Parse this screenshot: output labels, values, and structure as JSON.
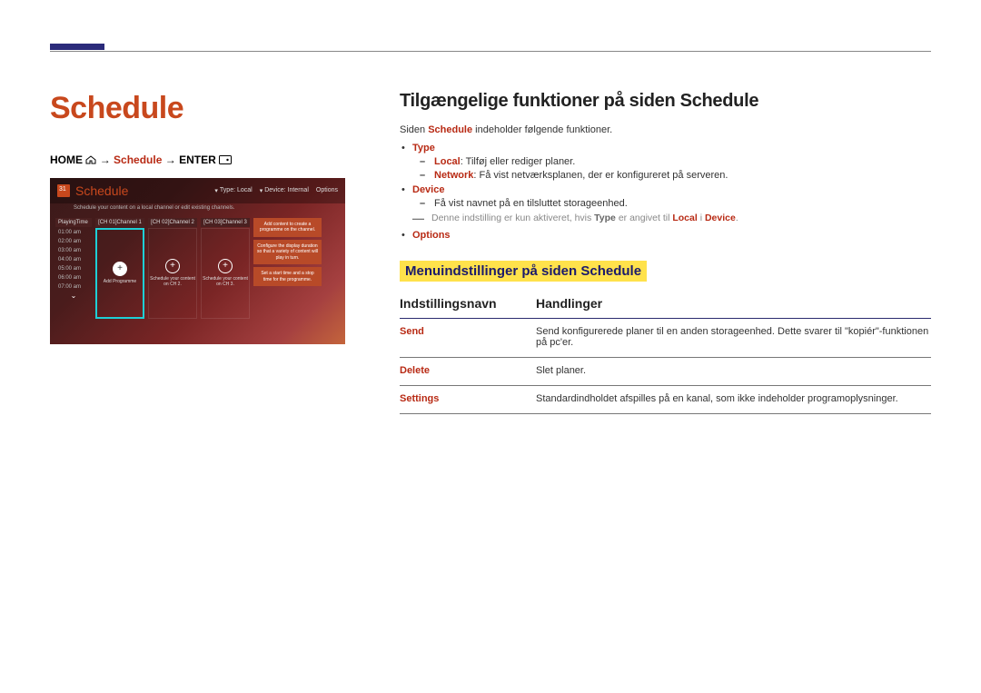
{
  "left": {
    "title": "Schedule",
    "breadcrumb_home": "HOME",
    "breadcrumb_arrow1": " → ",
    "breadcrumb_schedule": "Schedule",
    "breadcrumb_arrow2": " → ",
    "breadcrumb_enter": "ENTER"
  },
  "screenshot": {
    "title": "Schedule",
    "subtitle": "Schedule your content on a local channel or edit existing channels.",
    "hdr_type": "Type: Local",
    "hdr_device": "Device: Internal",
    "hdr_options": "Options",
    "time_head": "PlayingTime",
    "times": [
      "01:00 am",
      "02:00 am",
      "03:00 am",
      "04:00 am",
      "05:00 am",
      "06:00 am",
      "07:00 am"
    ],
    "channels": [
      {
        "title": "[CH 01]Channel 1",
        "label": "Add Programme"
      },
      {
        "title": "[CH 02]Channel 2",
        "label": "Schedule your content on CH 2."
      },
      {
        "title": "[CH 03]Channel 3",
        "label": "Schedule your content on CH 3."
      }
    ],
    "side": [
      "Add content to create a programme on the channel.",
      "Configure the display duration so that a variety of content will play in turn.",
      "Set a start time and a stop time for the programme."
    ]
  },
  "right": {
    "h2": "Tilgængelige funktioner på siden Schedule",
    "intro_pre": "Siden ",
    "intro_red": "Schedule",
    "intro_post": " indeholder følgende funktioner.",
    "items": {
      "type": {
        "label": "Type",
        "local_key": "Local",
        "local_text": ": Tilføj eller rediger planer.",
        "network_key": "Network",
        "network_text": ": Få vist netværksplanen, der er konfigureret på serveren."
      },
      "device": {
        "label": "Device",
        "text": "Få vist navnet på en tilsluttet storageenhed.",
        "note_pre": "Denne indstilling er kun aktiveret, hvis ",
        "note_type": "Type",
        "note_mid": " er angivet til ",
        "note_local": "Local",
        "note_sep": " i ",
        "note_device": "Device",
        "note_end": "."
      },
      "options": {
        "label": "Options"
      }
    },
    "section_title": "Menuindstillinger på siden Schedule",
    "table": {
      "col1": "Indstillingsnavn",
      "col2": "Handlinger",
      "rows": [
        {
          "name": "Send",
          "action": "Send konfigurerede planer til en anden storageenhed. Dette svarer til \"kopiér\"-funktionen på pc'er."
        },
        {
          "name": "Delete",
          "action": "Slet planer."
        },
        {
          "name": "Settings",
          "action": "Standardindholdet afspilles på en kanal, som ikke indeholder programoplysninger."
        }
      ]
    }
  }
}
